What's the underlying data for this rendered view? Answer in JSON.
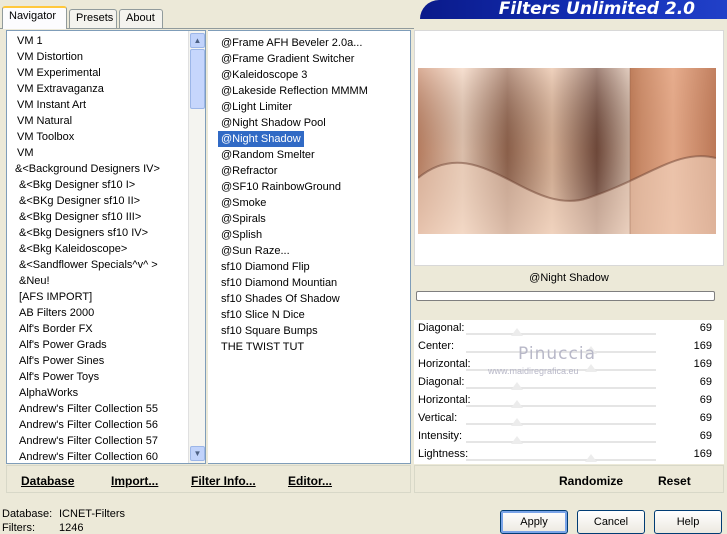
{
  "tabs": [
    {
      "label": "Navigator",
      "active": true
    },
    {
      "label": "Presets",
      "active": false
    },
    {
      "label": "About",
      "active": false
    }
  ],
  "app_title": "Filters Unlimited 2.0",
  "category_list": [
    "VM 1",
    "VM Distortion",
    "VM Experimental",
    "VM Extravaganza",
    "VM Instant Art",
    "VM Natural",
    "VM Toolbox",
    "VM",
    "&<Background Designers IV>",
    "&<Bkg Designer sf10 I>",
    "&<BKg Designer sf10 II>",
    "&<Bkg Designer sf10 III>",
    "&<Bkg Designers sf10 IV>",
    "&<Bkg Kaleidoscope>",
    "&<Sandflower Specials^v^ >",
    "&Neu!",
    "[AFS IMPORT]",
    "AB Filters 2000",
    "Alf's Border FX",
    "Alf's Power Grads",
    "Alf's Power Sines",
    "Alf's Power Toys",
    "AlphaWorks",
    "Andrew's Filter Collection 55",
    "Andrew's Filter Collection 56",
    "Andrew's Filter Collection 57",
    "Andrew's Filter Collection 60"
  ],
  "category_selected_index": 8,
  "filter_list": [
    "@Frame AFH Beveler 2.0a...",
    "@Frame Gradient Switcher",
    "@Kaleidoscope 3",
    "@Lakeside Reflection MMMM",
    "@Light Limiter",
    "@Night Shadow Pool",
    "@Night Shadow",
    "@Random Smelter",
    "@Refractor",
    "@SF10 RainbowGround",
    "@Smoke",
    "@Spirals",
    "@Splish",
    "@Sun Raze...",
    "sf10 Diamond Flip",
    "sf10 Diamond Mountian",
    "sf10 Shades Of Shadow",
    "sf10 Slice N Dice",
    "sf10 Square Bumps",
    "THE TWIST TUT"
  ],
  "filter_selected_index": 6,
  "preview": {
    "filter_name": "@Night Shadow"
  },
  "params": [
    {
      "label": "Diagonal:",
      "value": "69",
      "fraction": 0.27
    },
    {
      "label": "Center:",
      "value": "169",
      "fraction": 0.66
    },
    {
      "label": "Horizontal:",
      "value": "169",
      "fraction": 0.66
    },
    {
      "label": "Diagonal:",
      "value": "69",
      "fraction": 0.27
    },
    {
      "label": "Horizontal:",
      "value": "69",
      "fraction": 0.27
    },
    {
      "label": "Vertical:",
      "value": "69",
      "fraction": 0.27
    },
    {
      "label": "Intensity:",
      "value": "69",
      "fraction": 0.27
    },
    {
      "label": "Lightness:",
      "value": "169",
      "fraction": 0.66
    }
  ],
  "watermark": {
    "name": "Pinuccia",
    "url": "www.maidiregrafica.eu"
  },
  "bottom_left_buttons": {
    "database": "Database",
    "import": "Import...",
    "filter_info": "Filter Info...",
    "editor": "Editor..."
  },
  "bottom_right_buttons": {
    "randomize": "Randomize",
    "reset": "Reset"
  },
  "status": {
    "database_label": "Database:",
    "database_value": "ICNET-Filters",
    "filters_label": "Filters:",
    "filters_value": "1246"
  },
  "dialog_buttons": {
    "apply": "Apply",
    "cancel": "Cancel",
    "help": "Help"
  }
}
